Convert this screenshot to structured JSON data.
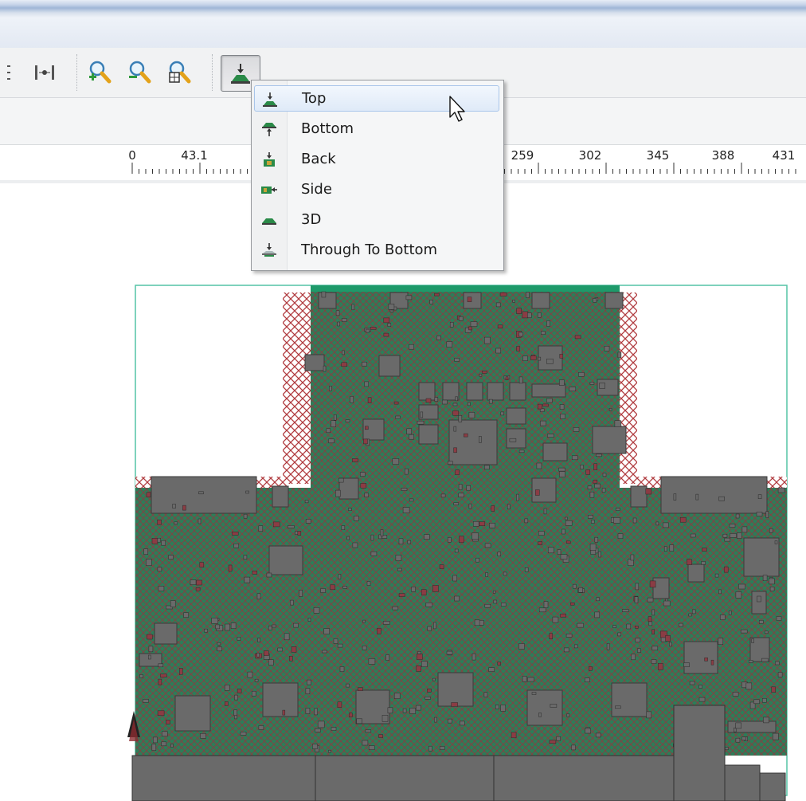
{
  "toolbar": {
    "buttons": [
      {
        "name": "align-left-icon"
      },
      {
        "name": "align-center-icon"
      },
      {
        "name": "zoom-in-icon"
      },
      {
        "name": "zoom-out-icon"
      },
      {
        "name": "zoom-fit-icon"
      },
      {
        "name": "view-top-icon",
        "pressed": true
      }
    ]
  },
  "view_menu": {
    "items": [
      {
        "label": "Top",
        "icon": "view-top-icon",
        "hovered": true
      },
      {
        "label": "Bottom",
        "icon": "view-bottom-icon"
      },
      {
        "label": "Back",
        "icon": "view-back-icon"
      },
      {
        "label": "Side",
        "icon": "view-side-icon"
      },
      {
        "label": "3D",
        "icon": "view-3d-icon"
      },
      {
        "label": "Through To Bottom",
        "icon": "view-through-icon"
      }
    ]
  },
  "ruler": {
    "ticks": [
      "0",
      "43.1",
      "259",
      "302",
      "345",
      "388",
      "431"
    ]
  },
  "colors": {
    "board_fill": "#2e7c58",
    "hatch_red": "#b03a3e",
    "component_grey": "#6a6a6a",
    "outline_teal": "#54c4a6"
  }
}
